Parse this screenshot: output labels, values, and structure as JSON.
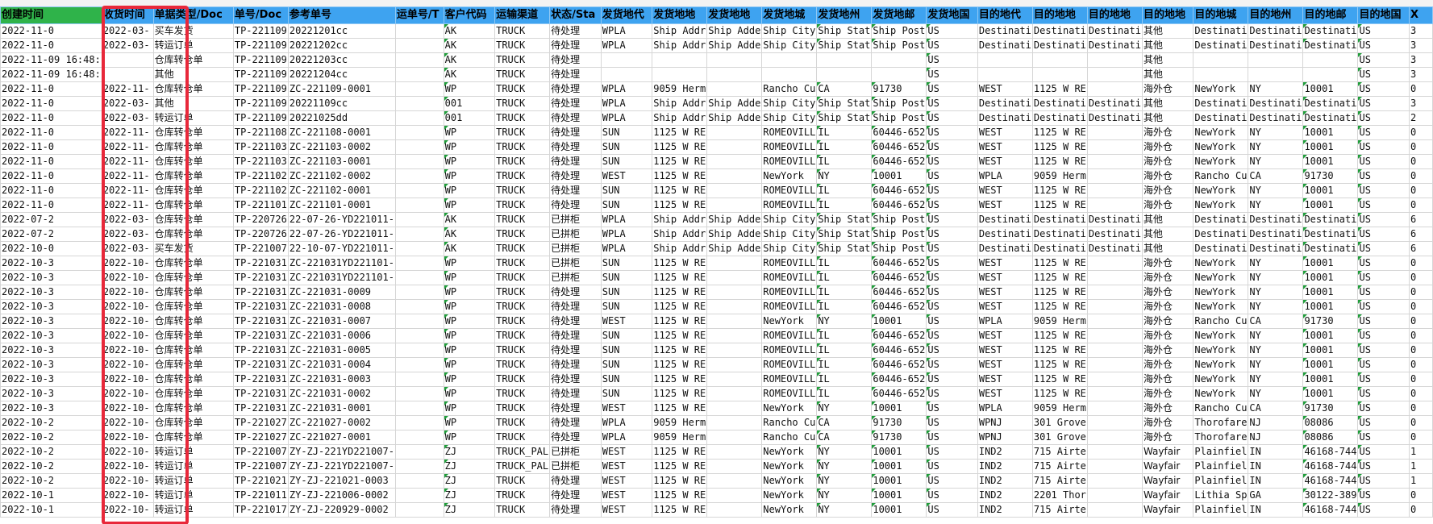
{
  "columns": [
    "创建时间",
    "收货时间",
    "单据类型/Doc",
    "单号/Doc",
    "参考单号",
    "运单号/T",
    "客户代码",
    "运输渠道",
    "状态/Sta",
    "发货地代",
    "发货地地",
    "发货地地",
    "发货地城",
    "发货地州",
    "发货地邮",
    "发货地国",
    "目的地代",
    "目的地地",
    "目的地地",
    "目的地地",
    "目的地城",
    "目的地州",
    "目的地邮",
    "目的地国",
    "X"
  ],
  "rows": [
    [
      "2022-11-0",
      "2022-03-",
      "买车发货",
      "TP-221109",
      "20221201cc",
      "",
      "AK",
      "TRUCK",
      "待处理",
      "WPLA",
      "Ship Addr",
      "Ship Adde",
      "Ship City",
      "Ship Stat",
      "Ship Post",
      "US",
      "Destinati",
      "Destinati",
      "Destinati",
      "其他",
      "Destinati",
      "Destinati",
      "Destinati",
      "US",
      "3"
    ],
    [
      "2022-11-0",
      "2022-03-",
      "转运订单",
      "TP-221109",
      "20221202cc",
      "",
      "AK",
      "TRUCK",
      "待处理",
      "WPLA",
      "Ship Addr",
      "Ship Adde",
      "Ship City",
      "Ship Stat",
      "Ship Post",
      "US",
      "Destinati",
      "Destinati",
      "Destinati",
      "其他",
      "Destinati",
      "Destinati",
      "Destinati",
      "US",
      "3"
    ],
    [
      "2022-11-09 16:48:",
      "",
      "仓库转仓单",
      "TP-221109",
      "20221203cc",
      "",
      "AK",
      "TRUCK",
      "待处理",
      "",
      "",
      "",
      "",
      "",
      "",
      "US",
      "",
      "",
      "",
      "其他",
      "",
      "",
      "",
      "US",
      "3"
    ],
    [
      "2022-11-09 16:48:",
      "",
      "其他",
      "TP-221109",
      "20221204cc",
      "",
      "AK",
      "TRUCK",
      "待处理",
      "",
      "",
      "",
      "",
      "",
      "",
      "US",
      "",
      "",
      "",
      "其他",
      "",
      "",
      "",
      "US",
      "3"
    ],
    [
      "2022-11-0",
      "2022-11-",
      "仓库转仓单",
      "TP-221109",
      "ZC-221109-0001",
      "",
      "WP",
      "TRUCK",
      "待处理",
      "WPLA",
      "9059 Herm",
      "",
      "Rancho Cu",
      "CA",
      "91730",
      "US",
      "WEST",
      "1125 W RE",
      "",
      "海外仓",
      "NewYork",
      "NY",
      "10001",
      "US",
      "0"
    ],
    [
      "2022-11-0",
      "2022-03-",
      "其他",
      "TP-221109",
      "20221109cc",
      "",
      "001",
      "TRUCK",
      "待处理",
      "WPLA",
      "Ship Addr",
      "Ship Adde",
      "Ship City",
      "Ship Stat",
      "Ship Post",
      "US",
      "Destinati",
      "Destinati",
      "Destinati",
      "其他",
      "Destinati",
      "Destinati",
      "Destinati",
      "US",
      "3"
    ],
    [
      "2022-11-0",
      "2022-03-",
      "转运订单",
      "TP-221109",
      "20221025dd",
      "",
      "001",
      "TRUCK",
      "待处理",
      "WPLA",
      "Ship Addr",
      "Ship Adde",
      "Ship City",
      "Ship Stat",
      "Ship Post",
      "US",
      "Destinati",
      "Destinati",
      "Destinati",
      "其他",
      "Destinati",
      "Destinati",
      "Destinati",
      "US",
      "2"
    ],
    [
      "2022-11-0",
      "2022-11-",
      "仓库转仓单",
      "TP-221108",
      "ZC-221108-0001",
      "",
      "WP",
      "TRUCK",
      "待处理",
      "SUN",
      "1125 W RE",
      "",
      "ROMEOVILL",
      "IL",
      "60446-652",
      "US",
      "WEST",
      "1125 W RE",
      "",
      "海外仓",
      "NewYork",
      "NY",
      "10001",
      "US",
      "0"
    ],
    [
      "2022-11-0",
      "2022-11-",
      "仓库转仓单",
      "TP-221103",
      "ZC-221103-0002",
      "",
      "WP",
      "TRUCK",
      "待处理",
      "SUN",
      "1125 W RE",
      "",
      "ROMEOVILL",
      "IL",
      "60446-652",
      "US",
      "WEST",
      "1125 W RE",
      "",
      "海外仓",
      "NewYork",
      "NY",
      "10001",
      "US",
      "0"
    ],
    [
      "2022-11-0",
      "2022-11-",
      "仓库转仓单",
      "TP-221103",
      "ZC-221103-0001",
      "",
      "WP",
      "TRUCK",
      "待处理",
      "SUN",
      "1125 W RE",
      "",
      "ROMEOVILL",
      "IL",
      "60446-652",
      "US",
      "WEST",
      "1125 W RE",
      "",
      "海外仓",
      "NewYork",
      "NY",
      "10001",
      "US",
      "0"
    ],
    [
      "2022-11-0",
      "2022-11-",
      "仓库转仓单",
      "TP-221102",
      "ZC-221102-0002",
      "",
      "WP",
      "TRUCK",
      "待处理",
      "WEST",
      "1125 W RE",
      "",
      "NewYork",
      "NY",
      "10001",
      "US",
      "WPLA",
      "9059 Herm",
      "",
      "海外仓",
      "Rancho Cu",
      "CA",
      "91730",
      "US",
      "0"
    ],
    [
      "2022-11-0",
      "2022-11-",
      "仓库转仓单",
      "TP-221102",
      "ZC-221102-0001",
      "",
      "WP",
      "TRUCK",
      "待处理",
      "SUN",
      "1125 W RE",
      "",
      "ROMEOVILL",
      "IL",
      "60446-652",
      "US",
      "WEST",
      "1125 W RE",
      "",
      "海外仓",
      "NewYork",
      "NY",
      "10001",
      "US",
      "0"
    ],
    [
      "2022-11-0",
      "2022-11-",
      "仓库转仓单",
      "TP-221101",
      "ZC-221101-0001",
      "",
      "WP",
      "TRUCK",
      "待处理",
      "SUN",
      "1125 W RE",
      "",
      "ROMEOVILL",
      "IL",
      "60446-652",
      "US",
      "WEST",
      "1125 W RE",
      "",
      "海外仓",
      "NewYork",
      "NY",
      "10001",
      "US",
      "0"
    ],
    [
      "2022-07-2",
      "2022-03-",
      "仓库转仓单",
      "TP-220726",
      "22-07-26-YD221011-",
      "",
      "AK",
      "TRUCK",
      "已拼柜",
      "WPLA",
      "Ship Addr",
      "Ship Adde",
      "Ship City",
      "Ship Stat",
      "Ship Post",
      "US",
      "Destinati",
      "Destinati",
      "Destinati",
      "其他",
      "Destinati",
      "Destinati",
      "Destinati",
      "US",
      "6"
    ],
    [
      "2022-07-2",
      "2022-03-",
      "仓库转仓单",
      "TP-220726",
      "22-07-26-YD221011-",
      "",
      "AK",
      "TRUCK",
      "已拼柜",
      "WPLA",
      "Ship Addr",
      "Ship Adde",
      "Ship City",
      "Ship Stat",
      "Ship Post",
      "US",
      "Destinati",
      "Destinati",
      "Destinati",
      "其他",
      "Destinati",
      "Destinati",
      "Destinati",
      "US",
      "6"
    ],
    [
      "2022-10-0",
      "2022-03-",
      "买车发货",
      "TP-221007",
      "22-10-07-YD221011-",
      "",
      "AK",
      "TRUCK",
      "已拼柜",
      "WPLA",
      "Ship Addr",
      "Ship Adde",
      "Ship City",
      "Ship Stat",
      "Ship Post",
      "US",
      "Destinati",
      "Destinati",
      "Destinati",
      "其他",
      "Destinati",
      "Destinati",
      "Destinati",
      "US",
      "6"
    ],
    [
      "2022-10-3",
      "2022-10-",
      "仓库转仓单",
      "TP-221031",
      "ZC-221031YD221101-",
      "",
      "WP",
      "TRUCK",
      "已拼柜",
      "SUN",
      "1125 W RE",
      "",
      "ROMEOVILL",
      "IL",
      "60446-652",
      "US",
      "WEST",
      "1125 W RE",
      "",
      "海外仓",
      "NewYork",
      "NY",
      "10001",
      "US",
      "0"
    ],
    [
      "2022-10-3",
      "2022-10-",
      "仓库转仓单",
      "TP-221031",
      "ZC-221031YD221101-",
      "",
      "WP",
      "TRUCK",
      "已拼柜",
      "SUN",
      "1125 W RE",
      "",
      "ROMEOVILL",
      "IL",
      "60446-652",
      "US",
      "WEST",
      "1125 W RE",
      "",
      "海外仓",
      "NewYork",
      "NY",
      "10001",
      "US",
      "0"
    ],
    [
      "2022-10-3",
      "2022-10-",
      "仓库转仓单",
      "TP-221031",
      "ZC-221031-0009",
      "",
      "WP",
      "TRUCK",
      "待处理",
      "SUN",
      "1125 W RE",
      "",
      "ROMEOVILL",
      "IL",
      "60446-652",
      "US",
      "WEST",
      "1125 W RE",
      "",
      "海外仓",
      "NewYork",
      "NY",
      "10001",
      "US",
      "0"
    ],
    [
      "2022-10-3",
      "2022-10-",
      "仓库转仓单",
      "TP-221031",
      "ZC-221031-0008",
      "",
      "WP",
      "TRUCK",
      "待处理",
      "SUN",
      "1125 W RE",
      "",
      "ROMEOVILL",
      "IL",
      "60446-652",
      "US",
      "WEST",
      "1125 W RE",
      "",
      "海外仓",
      "NewYork",
      "NY",
      "10001",
      "US",
      "0"
    ],
    [
      "2022-10-3",
      "2022-10-",
      "仓库转仓单",
      "TP-221031",
      "ZC-221031-0007",
      "",
      "WP",
      "TRUCK",
      "待处理",
      "WEST",
      "1125 W RE",
      "",
      "NewYork",
      "NY",
      "10001",
      "US",
      "WPLA",
      "9059 Herm",
      "",
      "海外仓",
      "Rancho Cu",
      "CA",
      "91730",
      "US",
      "0"
    ],
    [
      "2022-10-3",
      "2022-10-",
      "仓库转仓单",
      "TP-221031",
      "ZC-221031-0006",
      "",
      "WP",
      "TRUCK",
      "待处理",
      "SUN",
      "1125 W RE",
      "",
      "ROMEOVILL",
      "IL",
      "60446-652",
      "US",
      "WEST",
      "1125 W RE",
      "",
      "海外仓",
      "NewYork",
      "NY",
      "10001",
      "US",
      "0"
    ],
    [
      "2022-10-3",
      "2022-10-",
      "仓库转仓单",
      "TP-221031",
      "ZC-221031-0005",
      "",
      "WP",
      "TRUCK",
      "待处理",
      "SUN",
      "1125 W RE",
      "",
      "ROMEOVILL",
      "IL",
      "60446-652",
      "US",
      "WEST",
      "1125 W RE",
      "",
      "海外仓",
      "NewYork",
      "NY",
      "10001",
      "US",
      "0"
    ],
    [
      "2022-10-3",
      "2022-10-",
      "仓库转仓单",
      "TP-221031",
      "ZC-221031-0004",
      "",
      "WP",
      "TRUCK",
      "待处理",
      "SUN",
      "1125 W RE",
      "",
      "ROMEOVILL",
      "IL",
      "60446-652",
      "US",
      "WEST",
      "1125 W RE",
      "",
      "海外仓",
      "NewYork",
      "NY",
      "10001",
      "US",
      "0"
    ],
    [
      "2022-10-3",
      "2022-10-",
      "仓库转仓单",
      "TP-221031",
      "ZC-221031-0003",
      "",
      "WP",
      "TRUCK",
      "待处理",
      "SUN",
      "1125 W RE",
      "",
      "ROMEOVILL",
      "IL",
      "60446-652",
      "US",
      "WEST",
      "1125 W RE",
      "",
      "海外仓",
      "NewYork",
      "NY",
      "10001",
      "US",
      "0"
    ],
    [
      "2022-10-3",
      "2022-10-",
      "仓库转仓单",
      "TP-221031",
      "ZC-221031-0002",
      "",
      "WP",
      "TRUCK",
      "待处理",
      "SUN",
      "1125 W RE",
      "",
      "ROMEOVILL",
      "IL",
      "60446-652",
      "US",
      "WEST",
      "1125 W RE",
      "",
      "海外仓",
      "NewYork",
      "NY",
      "10001",
      "US",
      "0"
    ],
    [
      "2022-10-3",
      "2022-10-",
      "仓库转仓单",
      "TP-221031",
      "ZC-221031-0001",
      "",
      "WP",
      "TRUCK",
      "待处理",
      "WEST",
      "1125 W RE",
      "",
      "NewYork",
      "NY",
      "10001",
      "US",
      "WPLA",
      "9059 Herm",
      "",
      "海外仓",
      "Rancho Cu",
      "CA",
      "91730",
      "US",
      "0"
    ],
    [
      "2022-10-2",
      "2022-10-",
      "仓库转仓单",
      "TP-221027",
      "ZC-221027-0002",
      "",
      "WP",
      "TRUCK",
      "待处理",
      "WPLA",
      "9059 Herm",
      "",
      "Rancho Cu",
      "CA",
      "91730",
      "US",
      "WPNJ",
      "301 Grove",
      "",
      "海外仓",
      "Thorofare",
      "NJ",
      "08086",
      "US",
      "0"
    ],
    [
      "2022-10-2",
      "2022-10-",
      "仓库转仓单",
      "TP-221027",
      "ZC-221027-0001",
      "",
      "WP",
      "TRUCK",
      "待处理",
      "WPLA",
      "9059 Herm",
      "",
      "Rancho Cu",
      "CA",
      "91730",
      "US",
      "WPNJ",
      "301 Grove",
      "",
      "海外仓",
      "Thorofare",
      "NJ",
      "08086",
      "US",
      "0"
    ],
    [
      "2022-10-2",
      "2022-10-",
      "转运订单",
      "TP-221007",
      "ZY-ZJ-221YD221007-",
      "",
      "ZJ",
      "TRUCK_PAL",
      "已拼柜",
      "WEST",
      "1125 W RE",
      "",
      "NewYork",
      "NY",
      "10001",
      "US",
      "IND2",
      "715 Airte",
      "",
      "Wayfair",
      "Plainfiel",
      "IN",
      "46168-744",
      "US",
      "1"
    ],
    [
      "2022-10-2",
      "2022-10-",
      "转运订单",
      "TP-221007",
      "ZY-ZJ-221YD221007-",
      "",
      "ZJ",
      "TRUCK_PAL",
      "已拼柜",
      "WEST",
      "1125 W RE",
      "",
      "NewYork",
      "NY",
      "10001",
      "US",
      "IND2",
      "715 Airte",
      "",
      "Wayfair",
      "Plainfiel",
      "IN",
      "46168-744",
      "US",
      "1"
    ],
    [
      "2022-10-2",
      "2022-10-",
      "转运订单",
      "TP-221021",
      "ZY-ZJ-221021-0003",
      "",
      "ZJ",
      "TRUCK",
      "待处理",
      "WEST",
      "1125 W RE",
      "",
      "NewYork",
      "NY",
      "10001",
      "US",
      "IND2",
      "715 Airte",
      "",
      "Wayfair",
      "Plainfiel",
      "IN",
      "46168-744",
      "US",
      "1"
    ],
    [
      "2022-10-1",
      "2022-10-",
      "转运订单",
      "TP-221011",
      "ZY-ZJ-221006-0002",
      "",
      "ZJ",
      "TRUCK",
      "待处理",
      "WEST",
      "1125 W RE",
      "",
      "NewYork",
      "NY",
      "10001",
      "US",
      "IND2",
      "2201 Thor",
      "",
      "Wayfair",
      "Lithia Sp",
      "GA",
      "30122-389",
      "US",
      "0"
    ],
    [
      "2022-10-1",
      "2022-10-",
      "转运订单",
      "TP-221017",
      "ZY-ZJ-220929-0002",
      "",
      "ZJ",
      "TRUCK",
      "待处理",
      "WEST",
      "1125 W RE",
      "",
      "NewYork",
      "NY",
      "10001",
      "US",
      "IND2",
      "715 Airte",
      "",
      "Wayfair",
      "Plainfiel",
      "IN",
      "46168-744",
      "US",
      "0"
    ]
  ],
  "selected_header": "创建时间",
  "highlight_color": "#e8283a",
  "header_color": "#3ea3f0",
  "selected_header_color": "#2fb34a"
}
